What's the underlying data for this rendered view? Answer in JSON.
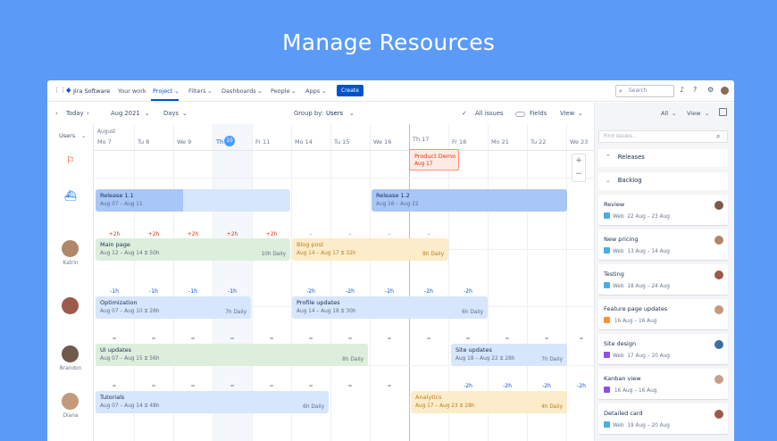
{
  "hero_title": "Manage Resources",
  "topbar": {
    "logo": "Jira Software",
    "nav": [
      "Your work",
      "Project",
      "Filters",
      "Dashboards",
      "People",
      "Apps"
    ],
    "create": "Create",
    "search_placeholder": "Search"
  },
  "toolbar": {
    "today": "Today",
    "month": "Aug 2021",
    "scale": "Days",
    "group_by_label": "Group by:",
    "group_by_value": "Users",
    "all_issues": "All issues",
    "fields": "Fields",
    "view": "View"
  },
  "header": {
    "users_label": "Users",
    "month_label": "August",
    "days": [
      "Mo 7",
      "Tu 8",
      "We 9",
      "Th",
      "Fr 11",
      "Mo 14",
      "Tu 15",
      "We 16",
      "Th 17",
      "Fr 18",
      "Mo 21",
      "Tu 22",
      "We 23"
    ],
    "today_num": "10"
  },
  "milestone": {
    "title": "Product Demo",
    "date": "Aug 17"
  },
  "zoom": {
    "in": "+",
    "out": "−"
  },
  "releases": [
    {
      "title": "Release 1.1",
      "dates": "Aug 07 – Aug 11"
    },
    {
      "title": "Release 1.2",
      "dates": "Aug 16 – Aug 22"
    }
  ],
  "users": [
    {
      "name": "Katrin",
      "capacity_row": [
        "+2h",
        "+2h",
        "+2h",
        "+2h",
        "+2h",
        "–",
        "–",
        "–",
        "–"
      ],
      "tasks": [
        {
          "title": "Main page",
          "meta": "Aug 12 – Aug 14  ⧖ 50h",
          "daily": "10h Daily"
        },
        {
          "title": "Blog post",
          "meta": "Aug 14 – Aug 17  ⧖ 32h",
          "daily": "8h Daily"
        }
      ]
    },
    {
      "name": "",
      "capacity_row": [
        "-1h",
        "-1h",
        "-1h",
        "-1h",
        "-2h",
        "-2h",
        "-2h",
        "-2h",
        "-2h"
      ],
      "tasks": [
        {
          "title": "Optimization",
          "meta": "Aug 07 – Aug 10  ⧖ 28h",
          "daily": "7h Daily"
        },
        {
          "title": "Profile updates",
          "meta": "Aug 14 – Aug 18  ⧖ 30h",
          "daily": "6h Daily"
        }
      ]
    },
    {
      "name": "Brandon",
      "capacity_row": [
        "=",
        "=",
        "=",
        "=",
        "=",
        "=",
        "=",
        "=",
        "=",
        "=",
        "=",
        "=",
        "="
      ],
      "tasks": [
        {
          "title": "UI updates",
          "meta": "Aug 07 – Aug 15  ⧖ 56h",
          "daily": "8h Daily"
        },
        {
          "title": "Site updates",
          "meta": "Aug 18 – Aug 22  ⧖ 28h",
          "daily": "7h Daily"
        }
      ]
    },
    {
      "name": "Diana",
      "capacity_row": [
        "=",
        "=",
        "=",
        "=",
        "=",
        "=",
        "=",
        "=",
        "-2h",
        "-2h",
        "-2h",
        "-2h"
      ],
      "tasks": [
        {
          "title": "Tutorials",
          "meta": "Aug 07 – Aug 14  ⧖ 48h",
          "daily": "6h Daily"
        },
        {
          "title": "Analytics",
          "meta": "Aug 17 – Aug 23  ⧖ 28h",
          "daily": "4h Daily"
        }
      ]
    }
  ],
  "sidebar": {
    "all": "All",
    "view": "View",
    "search_placeholder": "Find issues...",
    "releases": "Releases",
    "backlog": "Backlog",
    "cards": [
      {
        "title": "Review",
        "type": "Web",
        "dates": "22 Aug – 23 Aug",
        "color": "#4bade8"
      },
      {
        "title": "New pricing",
        "type": "Web",
        "dates": "13 Aug – 14 Aug",
        "color": "#4bade8"
      },
      {
        "title": "Testing",
        "type": "Web",
        "dates": "18 Aug – 24 Aug",
        "color": "#4bade8"
      },
      {
        "title": "Feature page updates",
        "type": "",
        "dates": "16 Aug – 16 Aug",
        "color": "#f79232"
      },
      {
        "title": "Site design",
        "type": "Web",
        "dates": "17 Aug – 20 Aug",
        "color": "#904ee2"
      },
      {
        "title": "Kanban view",
        "type": "",
        "dates": "16 Aug – 16 Aug",
        "color": "#904ee2"
      },
      {
        "title": "Detailed card",
        "type": "Web",
        "dates": "19 Aug – 20 Aug",
        "color": "#4bade8"
      }
    ]
  },
  "colors": {
    "brand": "#0052cc",
    "background": "#5b9bf7",
    "positive": "#de350b",
    "negative": "#0052cc"
  }
}
